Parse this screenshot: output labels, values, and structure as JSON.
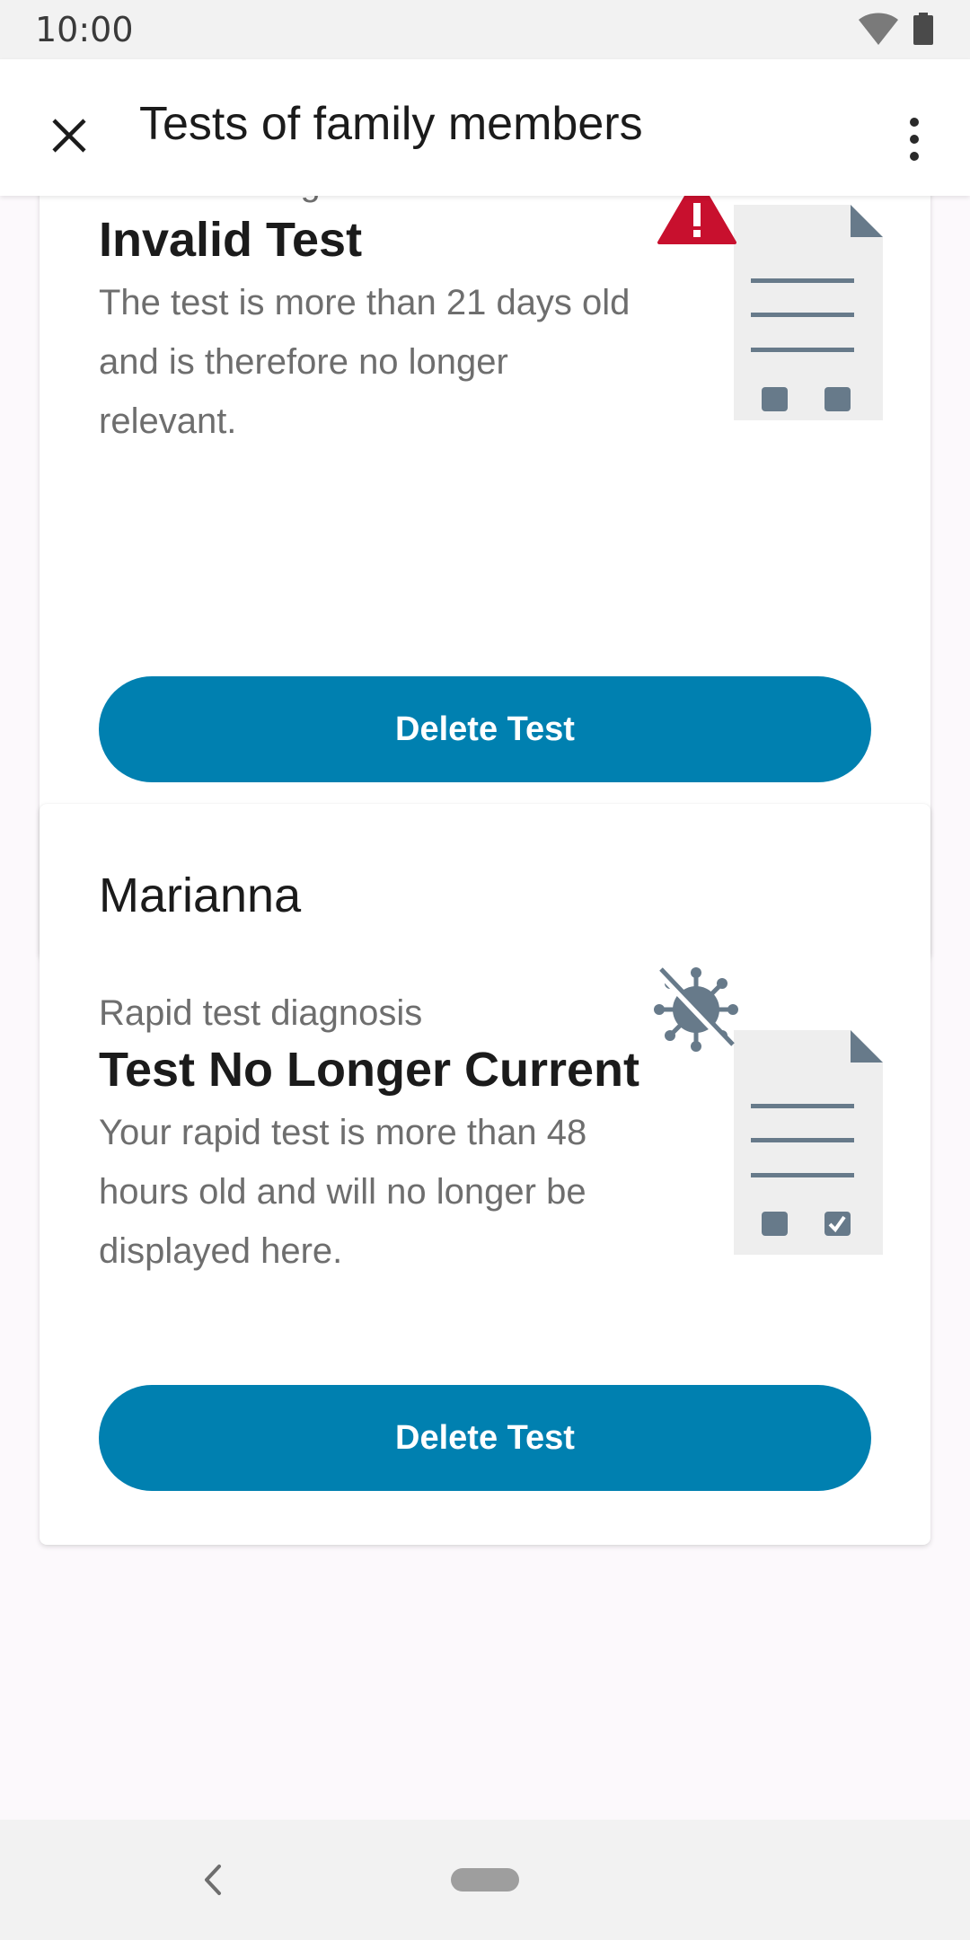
{
  "status_bar": {
    "time": "10:00",
    "icons": [
      "wifi-icon",
      "battery-icon"
    ]
  },
  "app_bar": {
    "title": "Tests of family members",
    "leading_icon": "close-icon",
    "trailing_icon": "more-vert-icon"
  },
  "cards": [
    {
      "member_name": null,
      "diagnosis_label": "PCR test diagnosis",
      "result_title": "Invalid Test",
      "description": "The test is more than 21 days old and is therefore no longer relevant.",
      "illustration": "invalid-test-document-warning-icon",
      "button_label": "Delete Test"
    },
    {
      "member_name": "Marianna",
      "diagnosis_label": "Rapid test diagnosis",
      "result_title": "Test No Longer Current",
      "description": "Your rapid test is more than 48 hours old and will no longer be displayed here.",
      "illustration": "expired-test-document-virus-icon",
      "button_label": "Delete Test"
    }
  ],
  "colors": {
    "primary": "#0080b0",
    "warning": "#c8102e",
    "illustration_gray": "#677a8a",
    "page_background": "#fcf9fc"
  },
  "nav_bar": {
    "icons": [
      "back-icon",
      "home-pill"
    ]
  }
}
